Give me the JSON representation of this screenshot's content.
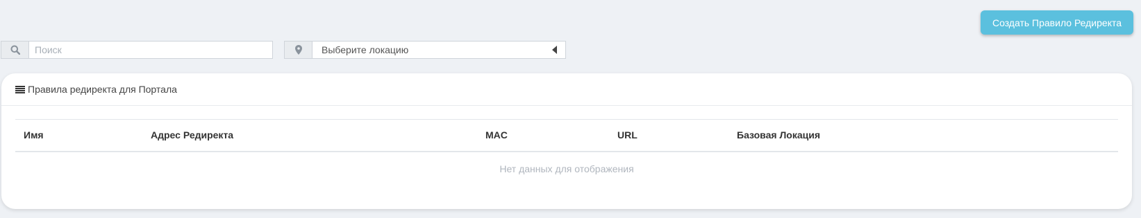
{
  "toolbar": {
    "create_button_label": "Создать Правило Редиректа"
  },
  "search": {
    "icon": "search-icon",
    "placeholder": "Поиск",
    "value": ""
  },
  "location": {
    "icon": "map-marker-icon",
    "selected": "Выберите локацию"
  },
  "panel": {
    "icon": "list-icon",
    "title": "Правила редиректа для Портала"
  },
  "table": {
    "columns": [
      "Имя",
      "Адрес Редиректа",
      "MAC",
      "URL",
      "Базовая Локация"
    ],
    "empty_message": "Нет данных для отображения"
  },
  "colors": {
    "page_background": "#eef1f5",
    "accent_button": "#5bc0de"
  }
}
